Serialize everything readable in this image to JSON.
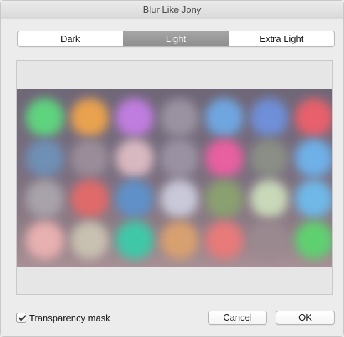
{
  "window": {
    "title": "Blur Like Jony"
  },
  "segments": {
    "items": [
      {
        "label": "Dark",
        "selected": false
      },
      {
        "label": "Light",
        "selected": true
      },
      {
        "label": "Extra Light",
        "selected": false
      }
    ]
  },
  "options": {
    "transparency_mask_label": "Transparency mask",
    "transparency_mask_checked": true
  },
  "buttons": {
    "cancel_label": "Cancel",
    "ok_label": "OK"
  },
  "preview": {
    "blob_colors": [
      "#5fd37e",
      "#e9a24f",
      "#c07de0",
      "#9a92a0",
      "#6fa6e0",
      "#6f8fd8",
      "#e8606c",
      "#6f8fb4",
      "#9a8c98",
      "#d8b8c0",
      "#9a92a2",
      "#e860a0",
      "#8a8e86",
      "#6fb0e8",
      "#a8a2aa",
      "#e06a6a",
      "#5f90c8",
      "#c8c8d8",
      "#8aa070",
      "#c8d8b8",
      "#6fb8e8",
      "#e8b0b0",
      "#c8c0b0",
      "#3fc8a8",
      "#d8a070",
      "#e87a7a",
      "#9a8a90",
      "#5fd070"
    ]
  }
}
